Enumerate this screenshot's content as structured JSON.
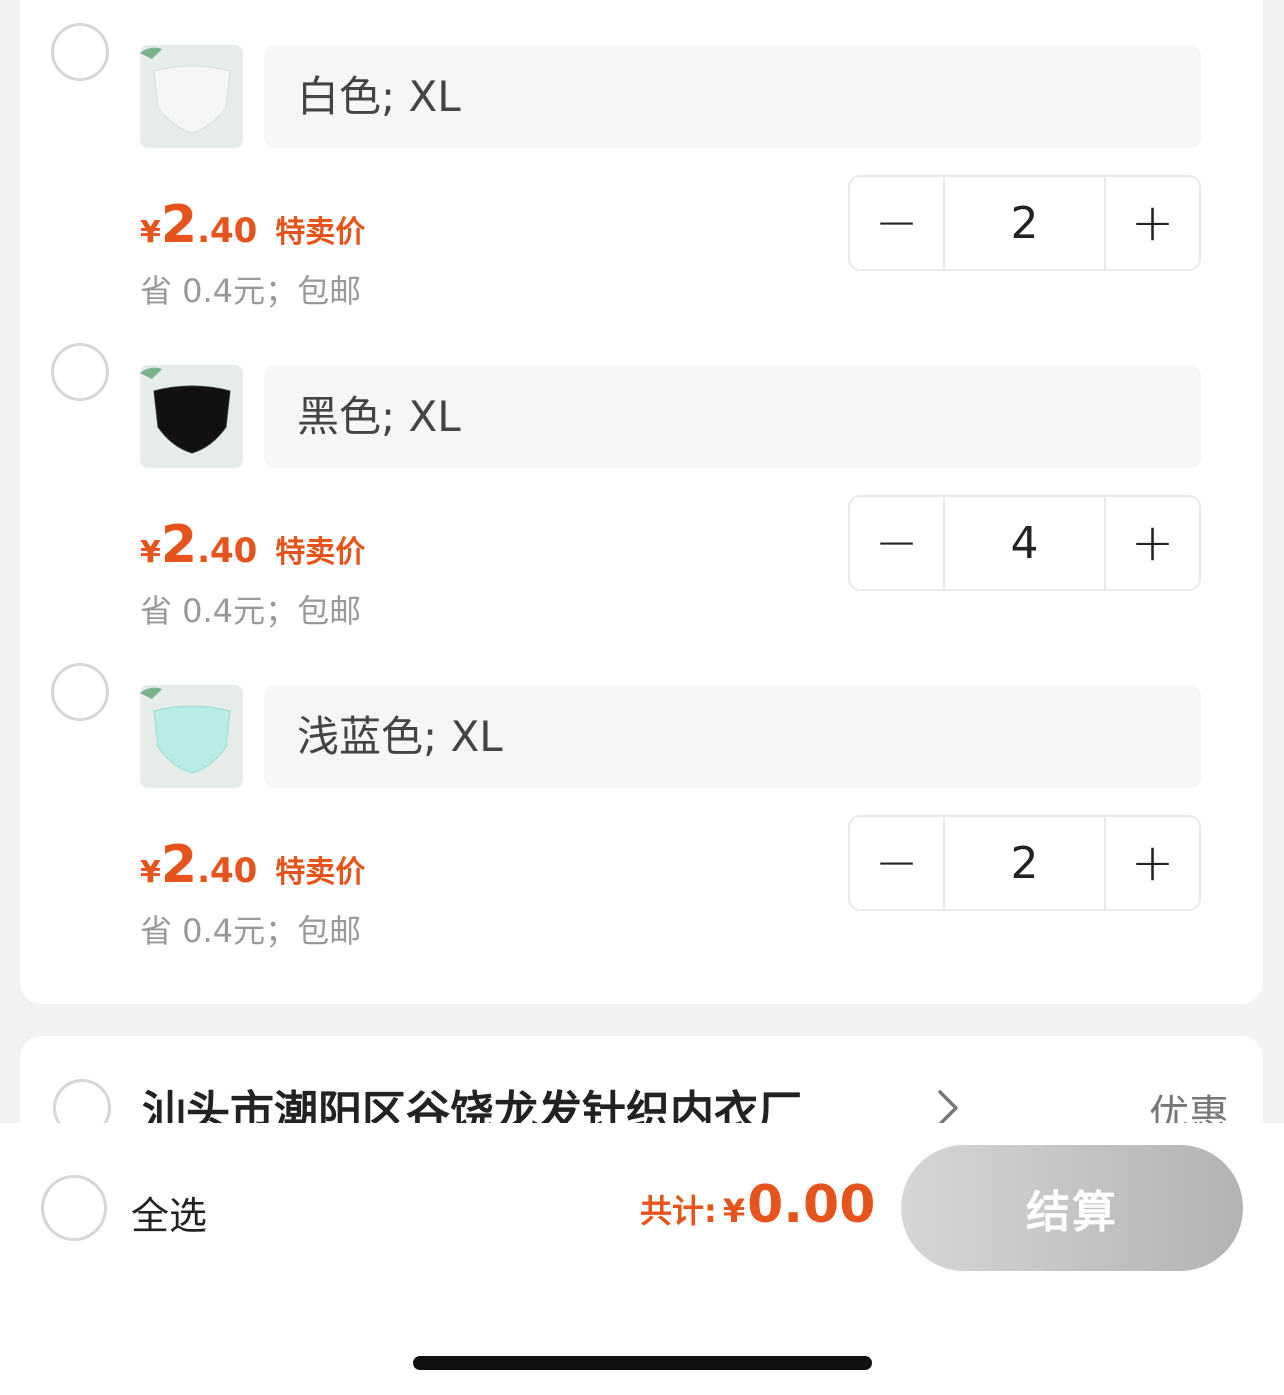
{
  "items": [
    {
      "sku": "白色; XL",
      "currency": "¥",
      "price_int": "2",
      "price_dec": ".40",
      "price_tag": "特卖价",
      "savings": "省 0.4元；包邮",
      "quantity": "2",
      "minus": "−",
      "plus": "+",
      "thumb_color": "#f4f6f5"
    },
    {
      "sku": "黑色; XL",
      "currency": "¥",
      "price_int": "2",
      "price_dec": ".40",
      "price_tag": "特卖价",
      "savings": "省 0.4元；包邮",
      "quantity": "4",
      "minus": "−",
      "plus": "+",
      "thumb_color": "#111111"
    },
    {
      "sku": "浅蓝色; XL",
      "currency": "¥",
      "price_int": "2",
      "price_dec": ".40",
      "price_tag": "特卖价",
      "savings": "省 0.4元；包邮",
      "quantity": "2",
      "minus": "−",
      "plus": "+",
      "thumb_color": "#b8ece6"
    }
  ],
  "shop": {
    "name": "汕头市潮阳区谷饶龙发针织内衣厂",
    "promo": "优惠"
  },
  "footer": {
    "select_all": "全选",
    "total_label": "共计:",
    "currency": "¥",
    "total_amount": "0.00",
    "checkout": "结算"
  },
  "colors": {
    "accent": "#e5541d",
    "checkout_disabled": "#bdbdbd"
  }
}
